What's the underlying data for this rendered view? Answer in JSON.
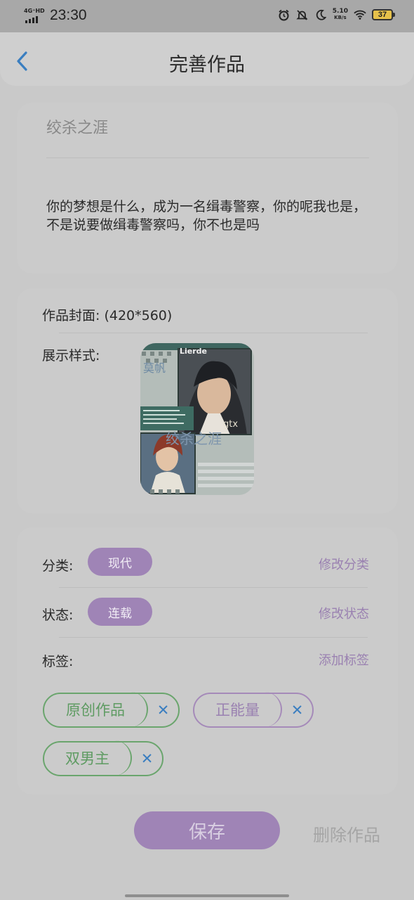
{
  "status_bar": {
    "network": "4G⁺HD",
    "time": "23:30",
    "speed_value": "5.10",
    "speed_unit": "KB/s",
    "battery": "37",
    "icons": [
      "alarm-icon",
      "mute-bell-icon",
      "moon-icon",
      "wifi-icon",
      "battery-icon"
    ]
  },
  "header": {
    "title": "完善作品",
    "back_icon": "chevron-left-icon"
  },
  "work": {
    "title": "绞杀之涯",
    "description": "你的梦想是什么，成为一名缉毒警察，你的呢我也是，不是说要做缉毒警察吗，你不也是吗"
  },
  "cover": {
    "label": "作品封面: (420*560)",
    "display_label": "展示样式:",
    "overlay_title": "绞杀之涯",
    "overlay_text_1": "莫帆",
    "overlay_text_2": "Lierde",
    "overlay_text_3": "gtx"
  },
  "meta": {
    "category_label": "分类:",
    "category_value": "现代",
    "category_action": "修改分类",
    "status_label": "状态:",
    "status_value": "连载",
    "status_action": "修改状态",
    "tags_label": "标签:",
    "tags_action": "添加标签",
    "tags": [
      {
        "label": "原创作品",
        "color": "#6aa56d",
        "remove": "✕"
      },
      {
        "label": "正能量",
        "color": "#a58ab9",
        "remove": "✕"
      },
      {
        "label": "双男主",
        "color": "#6aa56d",
        "remove": "✕"
      }
    ]
  },
  "footer": {
    "save": "保存",
    "delete": "删除作品"
  },
  "colors": {
    "accent": "#9f84b6",
    "link": "#9a81b1",
    "remove_icon": "#3a7ec0",
    "tag_green": "#6aa56d"
  }
}
